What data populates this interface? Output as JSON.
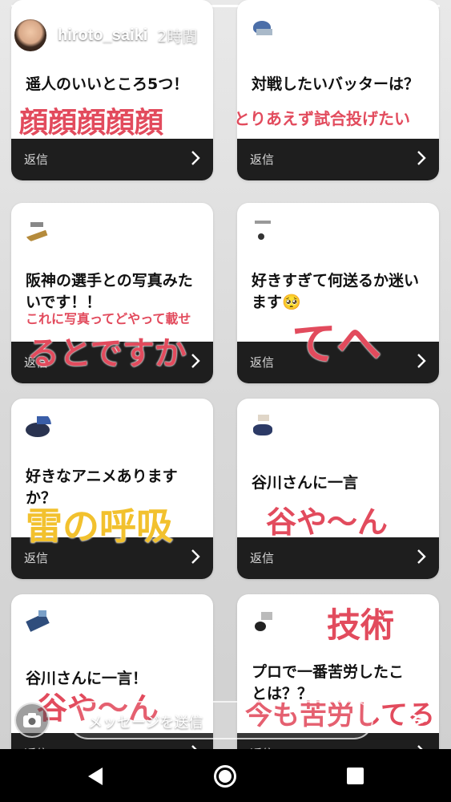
{
  "story": {
    "username": "hiroto_saiki",
    "time": "2時間"
  },
  "cards": [
    {
      "question": "遥人のいいところ5つ！",
      "reply_label": "返信"
    },
    {
      "question": "対戦したいバッターは？",
      "reply_label": "返信"
    },
    {
      "question": "阪神の選手との写真みたいです！！",
      "reply_label": "返信"
    },
    {
      "question": "好きすぎて何送るか迷います🥺",
      "reply_label": "返信"
    },
    {
      "question": "好きなアニメありますか？",
      "reply_label": "返信"
    },
    {
      "question": "谷川さんに一言",
      "reply_label": "返信"
    },
    {
      "question": "谷川さんに一言！",
      "reply_label": "返信"
    },
    {
      "question": "プロで一番苦労したことは？？",
      "reply_label": "返信"
    }
  ],
  "answers": [
    {
      "text": "顔顔顔顔顔",
      "color": "#e24b5d"
    },
    {
      "text": "とりあえず試合投げたい",
      "color": "#e24b5d"
    },
    {
      "text": "これに写真ってどやって載せ",
      "color": "#e24b5d"
    },
    {
      "text": "るとですか",
      "color": "#e24b5d"
    },
    {
      "text": "てへ",
      "color": "#e24b5d"
    },
    {
      "text": "雷の呼吸",
      "color": "#f2c12e"
    },
    {
      "text": "谷や〜ん",
      "color": "#e24b5d"
    },
    {
      "text": "谷や〜ん",
      "color": "#e24b5d"
    },
    {
      "text": "技術",
      "color": "#e24b5d"
    },
    {
      "text": "今も苦労してる",
      "color": "#e24b5d"
    }
  ],
  "message_bar": {
    "placeholder": "メッセージを送信"
  },
  "icons": {
    "camera": "camera-icon",
    "send": "send-icon",
    "back": "back-triangle-icon",
    "home": "home-circle-icon",
    "recent": "recent-apps-square-icon",
    "chevron": "chevron-right-icon"
  }
}
